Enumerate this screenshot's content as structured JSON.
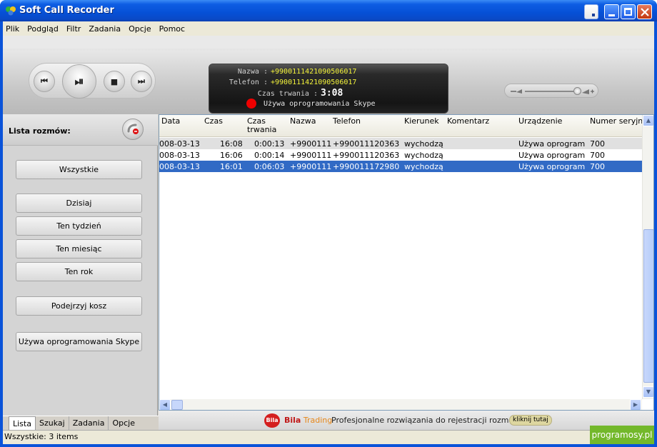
{
  "window": {
    "title": "Soft Call Recorder"
  },
  "menu": [
    "Plik",
    "Podgląd",
    "Filtr",
    "Zadania",
    "Opcje",
    "Pomoc"
  ],
  "player": {
    "prev": "⏮",
    "play_pause": "⏯",
    "stop": "■",
    "next": "⏭"
  },
  "display": {
    "name_label": "Nazwa :",
    "name_value": "+99001114210905060​17",
    "phone_label": "Telefon :",
    "phone_value": "+99001114210905060​17",
    "duration_label": "Czas trwania :",
    "duration_value": "3:08",
    "status": "Używa oprogramowania Skype"
  },
  "sidebar": {
    "title": "Lista rozmów:",
    "buttons": [
      "Wszystkie",
      "Dzisiaj",
      "Ten tydzień",
      "Ten miesiąc",
      "Ten rok",
      "Podejrzyj kosz",
      "Używa oprogramowania Skype"
    ]
  },
  "table": {
    "columns": [
      "Data",
      "Czas",
      "Czas trwania",
      "Nazwa",
      "Telefon",
      "Kierunek",
      "Komentarz",
      "Urządzenie",
      "Numer seryjny"
    ],
    "rows": [
      [
        "008-03-13",
        "16:08",
        "0:00:13",
        "+9900111",
        "+990011120363",
        "wychodzą",
        "",
        "Używa oprogram",
        "700"
      ],
      [
        "008-03-13",
        "16:06",
        "0:00:14",
        "+9900111",
        "+990011120363",
        "wychodzą",
        "",
        "Używa oprogram",
        "700"
      ],
      [
        "008-03-13",
        "16:01",
        "0:06:03",
        "+9900111",
        "+990011172980",
        "wychodzą",
        "",
        "Używa oprogram",
        "700"
      ]
    ],
    "selected_row": 2
  },
  "bottom_tabs": [
    "Lista",
    "Szukaj",
    "Zadania",
    "Opcje"
  ],
  "status": "Wszystkie: 3 items",
  "promo": {
    "logo": "Bila",
    "brand_a": "Bila",
    "brand_b": "Trading",
    "text": "Profesjonalne rozwiązania do rejestracji rozmów",
    "button": "kliknij tutaj"
  },
  "watermark": "programosy.pl",
  "colors": {
    "titlebar": "#0a53d9",
    "selection": "#316ac5",
    "display_value": "#f2f23a",
    "record": "#ee0000"
  }
}
